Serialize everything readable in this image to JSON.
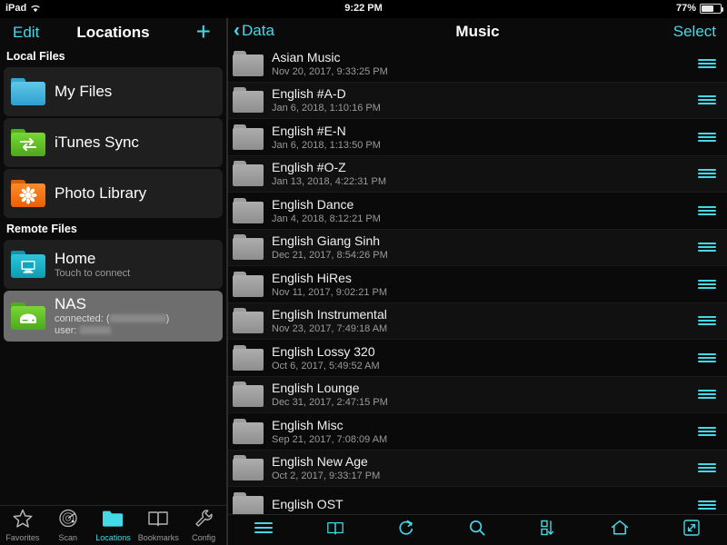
{
  "status_bar": {
    "device": "iPad",
    "wifi_icon": "wifi-icon",
    "time": "9:22 PM",
    "battery_percent": "77%",
    "battery_icon": "battery-icon"
  },
  "sidebar": {
    "navbar": {
      "edit_label": "Edit",
      "title": "Locations",
      "add_icon": "plus-icon"
    },
    "groups": [
      {
        "header": "Local Files",
        "items": [
          {
            "title": "My Files",
            "subtitle": "",
            "icon": "blue-folder-icon",
            "selected": false
          },
          {
            "title": "iTunes Sync",
            "subtitle": "",
            "icon": "green-sync-folder-icon",
            "selected": false
          },
          {
            "title": "Photo Library",
            "subtitle": "",
            "icon": "orange-photo-folder-icon",
            "selected": false
          }
        ]
      },
      {
        "header": "Remote Files",
        "items": [
          {
            "title": "Home",
            "subtitle": "Touch to connect",
            "icon": "teal-computer-folder-icon",
            "selected": false
          },
          {
            "title": "NAS",
            "subtitle_connected_label": "connected:",
            "subtitle_user_label": "user:",
            "icon": "green-disk-folder-icon",
            "selected": true
          }
        ]
      }
    ],
    "tabbar": [
      {
        "label": "Favorites",
        "icon": "star-icon",
        "active": false
      },
      {
        "label": "Scan",
        "icon": "radar-icon",
        "active": false
      },
      {
        "label": "Locations",
        "icon": "folder-icon",
        "active": true
      },
      {
        "label": "Bookmarks",
        "icon": "book-icon",
        "active": false
      },
      {
        "label": "Config",
        "icon": "wrench-icon",
        "active": false
      }
    ]
  },
  "detail": {
    "navbar": {
      "back_label": "Data",
      "back_icon": "chevron-left-icon",
      "title": "Music",
      "select_label": "Select"
    },
    "rows": [
      {
        "name": "Asian Music",
        "date": "Nov 20, 2017, 9:33:25 PM"
      },
      {
        "name": "English #A-D",
        "date": "Jan 6, 2018, 1:10:16 PM"
      },
      {
        "name": "English #E-N",
        "date": "Jan 6, 2018, 1:13:50 PM"
      },
      {
        "name": "English #O-Z",
        "date": "Jan 13, 2018, 4:22:31 PM"
      },
      {
        "name": "English Dance",
        "date": "Jan 4, 2018, 8:12:21 PM"
      },
      {
        "name": "English Giang Sinh",
        "date": "Dec 21, 2017, 8:54:26 PM"
      },
      {
        "name": "English HiRes",
        "date": "Nov 11, 2017, 9:02:21 PM"
      },
      {
        "name": "English Instrumental",
        "date": "Nov 23, 2017, 7:49:18 AM"
      },
      {
        "name": "English Lossy 320",
        "date": "Oct 6, 2017, 5:49:52 AM"
      },
      {
        "name": "English Lounge",
        "date": "Dec 31, 2017, 2:47:15 PM"
      },
      {
        "name": "English Misc",
        "date": "Sep 21, 2017, 7:08:09 AM"
      },
      {
        "name": "English New Age",
        "date": "Oct 2, 2017, 9:33:17 PM"
      },
      {
        "name": "English OST",
        "date": ""
      }
    ],
    "row_accessory_icon": "hamburger-reorder-icon",
    "toolbar": [
      {
        "icon": "list-menu-icon"
      },
      {
        "icon": "book-icon"
      },
      {
        "icon": "refresh-icon"
      },
      {
        "icon": "search-icon"
      },
      {
        "icon": "sort-icon"
      },
      {
        "icon": "home-icon"
      },
      {
        "icon": "expand-icon"
      }
    ]
  },
  "colors": {
    "accent": "#45d9e8",
    "background": "#0a0a0a",
    "card": "#1f1f1f",
    "selected_card": "#6e6e6e",
    "folder_blue": "#3fb6e0",
    "folder_green": "#5cc62b",
    "folder_orange": "#f07515",
    "folder_teal": "#18b3c9",
    "text_primary": "#ffffff",
    "text_secondary": "#9a9a9a"
  }
}
